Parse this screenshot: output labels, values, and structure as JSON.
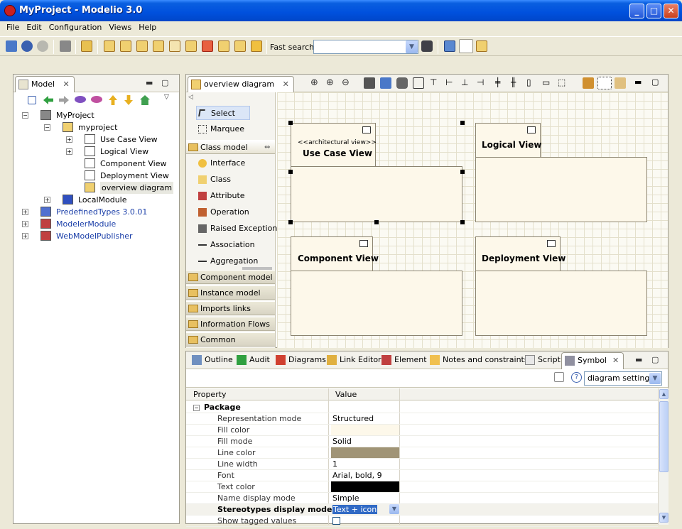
{
  "window": {
    "title": "MyProject - Modelio 3.0",
    "minimize": "_",
    "maximize": "□",
    "close": "✕"
  },
  "menubar": [
    "File",
    "Edit",
    "Configuration",
    "Views",
    "Help"
  ],
  "toolbar": {
    "fast_search_label": "Fast search:",
    "fast_search_value": ""
  },
  "model_panel": {
    "tab_label": "Model",
    "tree": [
      {
        "label": "MyProject",
        "level": 0,
        "expander": "−",
        "kind": "project"
      },
      {
        "label": "myproject",
        "level": 1,
        "expander": "−",
        "kind": "folder"
      },
      {
        "label": "Use Case View",
        "level": 2,
        "expander": "+",
        "kind": "package"
      },
      {
        "label": "Logical View",
        "level": 2,
        "expander": "+",
        "kind": "package"
      },
      {
        "label": "Component View",
        "level": 2,
        "expander": "",
        "kind": "package"
      },
      {
        "label": "Deployment View",
        "level": 2,
        "expander": "",
        "kind": "package"
      },
      {
        "label": "overview diagram",
        "level": 2,
        "expander": "",
        "kind": "diagram",
        "selected": true
      },
      {
        "label": "LocalModule",
        "level": 1,
        "expander": "+",
        "kind": "module"
      },
      {
        "label": "PredefinedTypes 3.0.01",
        "level": 0,
        "expander": "+",
        "kind": "library",
        "link": true
      },
      {
        "label": "ModelerModule",
        "level": 0,
        "expander": "+",
        "kind": "module-ext",
        "link": true
      },
      {
        "label": "WebModelPublisher",
        "level": 0,
        "expander": "+",
        "kind": "module-ext",
        "link": true
      }
    ]
  },
  "diagram_panel": {
    "tab_label": "overview diagram",
    "palette": {
      "tools": [
        {
          "label": "Select",
          "selected": true
        },
        {
          "label": "Marquee"
        }
      ],
      "class_model_drawer": "Class model",
      "class_model_items": [
        "Interface",
        "Class",
        "Attribute",
        "Operation",
        "Raised Exception",
        "Association",
        "Aggregation"
      ],
      "drawers": [
        "Component model",
        "Instance model",
        "Imports links",
        "Information Flows",
        "Common"
      ]
    },
    "packages": [
      {
        "name": "Use Case View",
        "stereotype": "<<architectural view>>"
      },
      {
        "name": "Logical View"
      },
      {
        "name": "Component View"
      },
      {
        "name": "Deployment View"
      }
    ]
  },
  "bottom_panel": {
    "tabs": [
      "Outline",
      "Audit",
      "Diagrams",
      "Link Editor",
      "Element",
      "Notes and constraints",
      "Script",
      "Symbol"
    ],
    "active_tab": "Symbol",
    "settings_select": "diagram settings",
    "columns": {
      "property": "Property",
      "value": "Value"
    },
    "section": "Package",
    "section_expander": "−",
    "rows": [
      {
        "name": "Representation mode",
        "value": "Structured"
      },
      {
        "name": "Fill color",
        "value": "",
        "swatch": "#fdf8ea"
      },
      {
        "name": "Fill mode",
        "value": "Solid"
      },
      {
        "name": "Line color",
        "value": "",
        "swatch": "#a09476"
      },
      {
        "name": "Line width",
        "value": "1"
      },
      {
        "name": "Font",
        "value": "Arial, bold, 9"
      },
      {
        "name": "Text color",
        "value": "",
        "swatch": "#000000"
      },
      {
        "name": "Name display mode",
        "value": "Simple"
      },
      {
        "name": "Stereotypes display mode",
        "value": "Text + icon",
        "bold": true,
        "editing": true
      },
      {
        "name": "Show tagged values",
        "value": "",
        "checkbox": true
      }
    ]
  }
}
